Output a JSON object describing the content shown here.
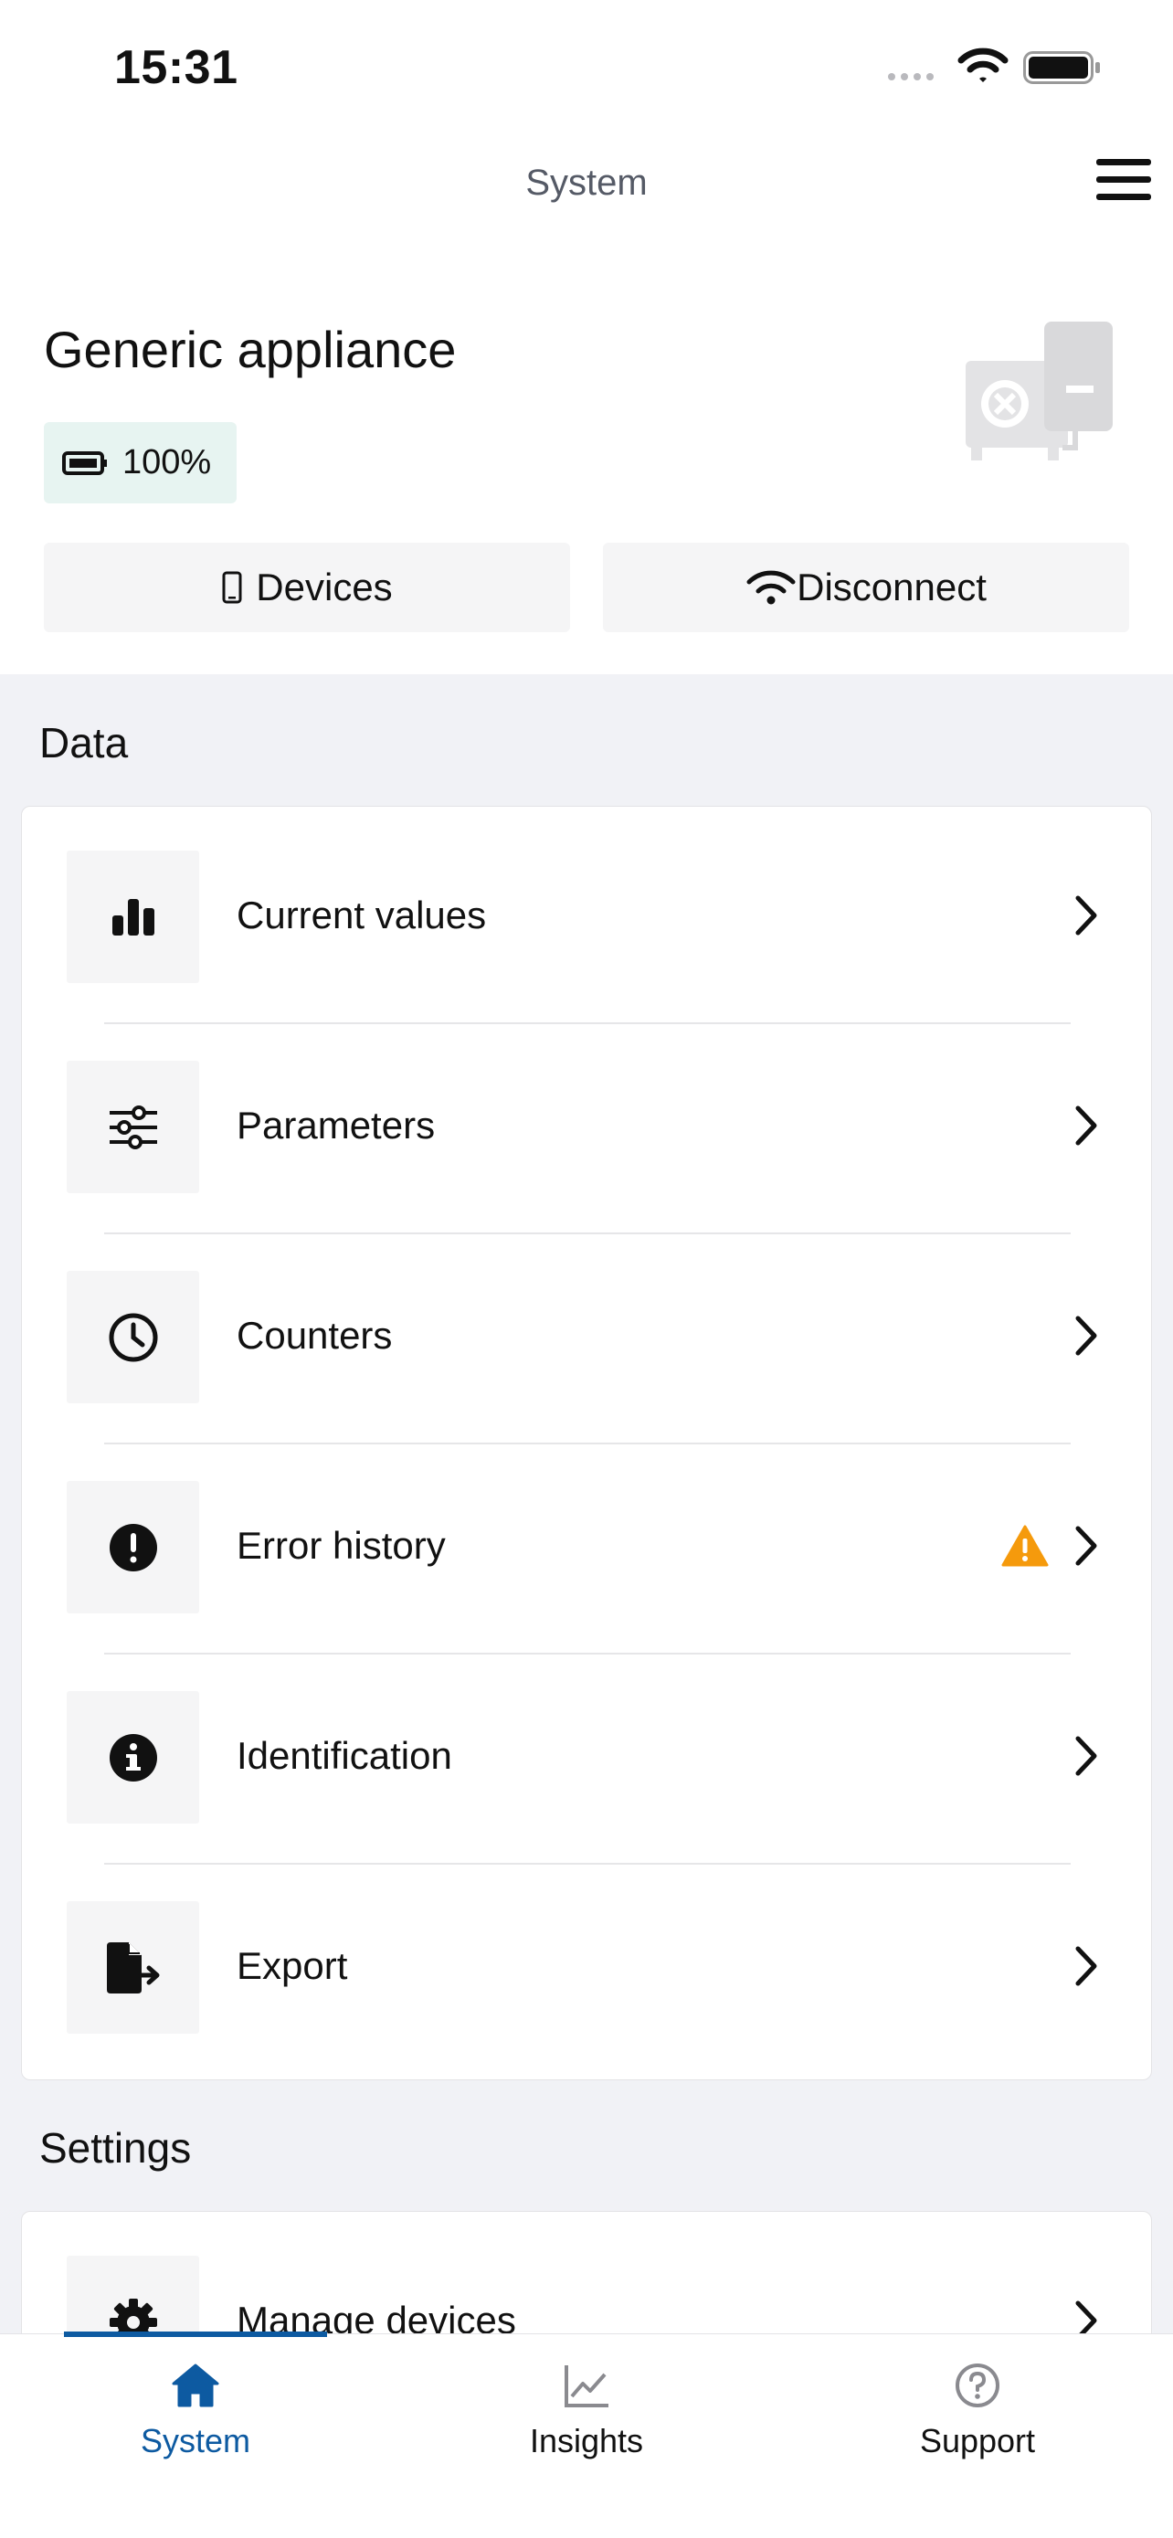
{
  "status_bar": {
    "time": "15:31"
  },
  "header": {
    "title": "System"
  },
  "appliance": {
    "name": "Generic appliance",
    "battery": "100%"
  },
  "actions": {
    "devices_label": "Devices",
    "disconnect_label": "Disconnect"
  },
  "data_section": {
    "title": "Data",
    "items": [
      {
        "label": "Current values",
        "icon": "bar-chart-icon"
      },
      {
        "label": "Parameters",
        "icon": "sliders-icon"
      },
      {
        "label": "Counters",
        "icon": "clock-icon"
      },
      {
        "label": "Error history",
        "icon": "exclamation-circle-icon",
        "warning": true
      },
      {
        "label": "Identification",
        "icon": "info-circle-icon"
      },
      {
        "label": "Export",
        "icon": "file-export-icon"
      }
    ]
  },
  "settings_section": {
    "title": "Settings",
    "items": [
      {
        "label": "Manage devices",
        "icon": "gear-icon"
      }
    ]
  },
  "tabbar": {
    "tabs": [
      {
        "label": "System",
        "icon": "home-icon",
        "active": true
      },
      {
        "label": "Insights",
        "icon": "line-chart-icon",
        "active": false
      },
      {
        "label": "Support",
        "icon": "question-circle-icon",
        "active": false
      }
    ]
  },
  "colors": {
    "accent": "#0d5aa1",
    "warning": "#f59a0c",
    "battery_badge_bg": "#e7f4f1",
    "section_bg": "#f1f2f6"
  }
}
